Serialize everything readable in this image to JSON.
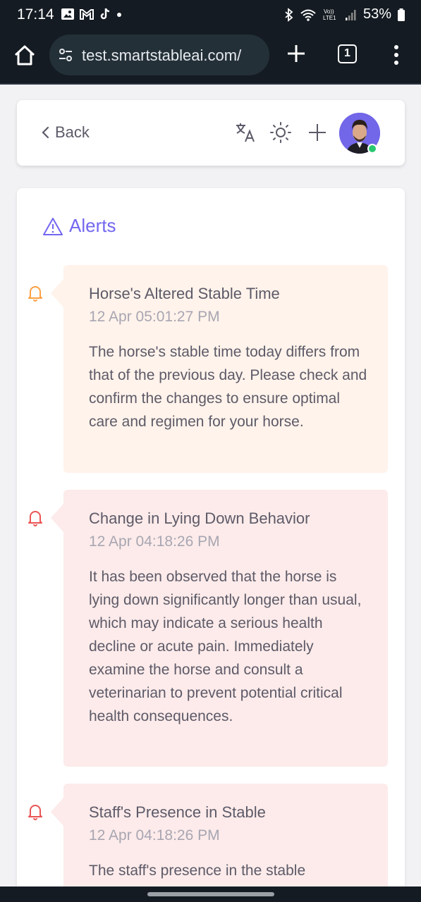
{
  "status_bar": {
    "time": "17:14",
    "battery": "53%",
    "left_icons": [
      "gallery-icon",
      "gmail-icon",
      "tiktok-icon",
      "dot-icon"
    ],
    "right_icons": [
      "bluetooth-icon",
      "wifi-icon",
      "volte-icon",
      "signal-icon",
      "battery-icon"
    ],
    "volte_label": "Vo)) LTE1"
  },
  "browser": {
    "url": "test.smartstableai.com/",
    "tab_count": "1"
  },
  "header": {
    "back_label": "Back",
    "icons": [
      "translate-icon",
      "sun-icon",
      "plus-icon"
    ],
    "online_color": "#28c76f"
  },
  "alerts": {
    "title": "Alerts",
    "accent_color": "#7367f0",
    "items": [
      {
        "severity": "warning",
        "bell_color": "#ff9f43",
        "title": "Horse's Altered Stable Time",
        "time": "12 Apr 05:01:27 PM",
        "body": "The horse's stable time today differs from that of the previous day. Please check and confirm the changes to ensure optimal care and regimen for your horse."
      },
      {
        "severity": "danger",
        "bell_color": "#ea5455",
        "title": "Change in Lying Down Behavior",
        "time": "12 Apr 04:18:26 PM",
        "body": "It has been observed that the horse is lying down significantly longer than usual, which may indicate a serious health decline or acute pain. Immediately examine the horse and consult a veterinarian to prevent potential critical health consequences."
      },
      {
        "severity": "danger",
        "bell_color": "#ea5455",
        "title": "Staff's Presence in Stable",
        "time": "12 Apr 04:18:26 PM",
        "body": "The staff's presence in the stable"
      }
    ]
  }
}
